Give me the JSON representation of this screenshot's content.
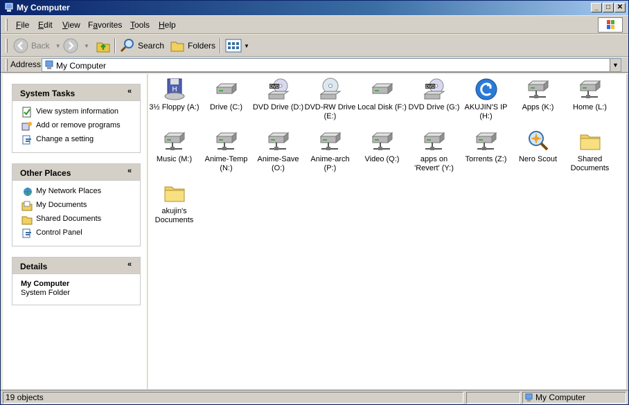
{
  "window": {
    "title": "My Computer"
  },
  "titlebar_buttons": {
    "minimize": "_",
    "maximize": "□",
    "close": "✕"
  },
  "menu": [
    {
      "label": "File",
      "accel": "F"
    },
    {
      "label": "Edit",
      "accel": "E"
    },
    {
      "label": "View",
      "accel": "V"
    },
    {
      "label": "Favorites",
      "accel": "a"
    },
    {
      "label": "Tools",
      "accel": "T"
    },
    {
      "label": "Help",
      "accel": "H"
    }
  ],
  "toolbar": {
    "back": "Back",
    "search": "Search",
    "folders": "Folders"
  },
  "address": {
    "label": "Address",
    "value": "My Computer"
  },
  "panels": {
    "system_tasks": {
      "title": "System Tasks",
      "items": [
        "View system information",
        "Add or remove programs",
        "Change a setting"
      ]
    },
    "other_places": {
      "title": "Other Places",
      "items": [
        "My Network Places",
        "My Documents",
        "Shared Documents",
        "Control Panel"
      ]
    },
    "details": {
      "title": "Details",
      "name": "My Computer",
      "type": "System Folder"
    }
  },
  "items": [
    {
      "label": "3½ Floppy (A:)",
      "icon": "floppy-drive-icon"
    },
    {
      "label": "Drive (C:)",
      "icon": "hard-drive-icon"
    },
    {
      "label": "DVD Drive (D:)",
      "icon": "dvd-drive-icon"
    },
    {
      "label": "DVD-RW Drive (E:)",
      "icon": "cd-drive-icon"
    },
    {
      "label": "Local Disk (F:)",
      "icon": "hard-drive-icon"
    },
    {
      "label": "DVD Drive (G:)",
      "icon": "dvd-drive-icon"
    },
    {
      "label": "AKUJIN'S IP (H:)",
      "icon": "network-app-icon"
    },
    {
      "label": "Apps (K:)",
      "icon": "network-drive-icon"
    },
    {
      "label": "Home (L:)",
      "icon": "network-drive-icon"
    },
    {
      "label": "Music (M:)",
      "icon": "network-drive-icon"
    },
    {
      "label": "Anime-Temp (N:)",
      "icon": "network-drive-icon"
    },
    {
      "label": "Anime-Save (O:)",
      "icon": "network-drive-icon"
    },
    {
      "label": "Anime-arch (P:)",
      "icon": "network-drive-icon"
    },
    {
      "label": "Video (Q:)",
      "icon": "network-drive-icon"
    },
    {
      "label": "apps on 'Revert' (Y:)",
      "icon": "network-drive-icon"
    },
    {
      "label": "Torrents (Z:)",
      "icon": "network-drive-icon"
    },
    {
      "label": "Nero Scout",
      "icon": "nero-scout-icon"
    },
    {
      "label": "Shared Documents",
      "icon": "folder-icon"
    },
    {
      "label": "akujin's Documents",
      "icon": "folder-icon"
    }
  ],
  "status": {
    "count": "19 objects",
    "location": "My Computer"
  },
  "colors": {
    "titlebar": "#0a246a",
    "face": "#d4d0c8",
    "content": "#ffffff"
  }
}
